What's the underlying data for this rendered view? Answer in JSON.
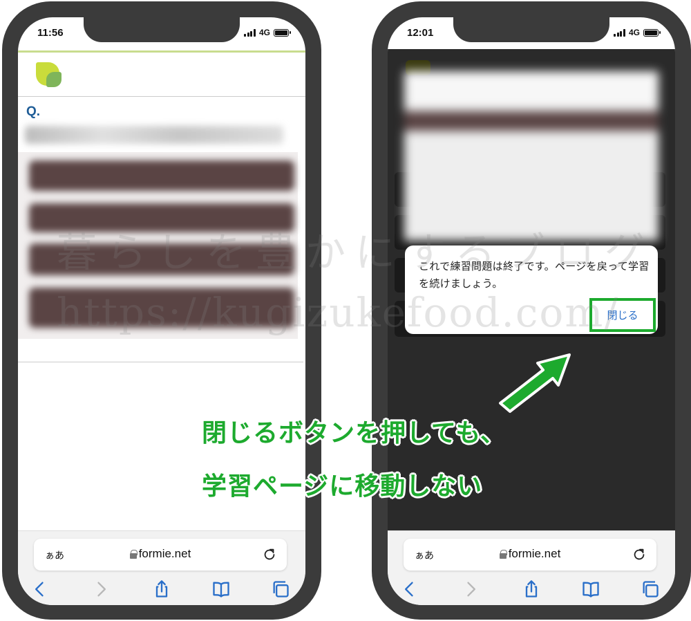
{
  "left_phone": {
    "status_time": "11:56",
    "network": "4G",
    "question_label": "Q.",
    "url_aa": "ぁあ",
    "url": "formie.net"
  },
  "right_phone": {
    "status_time": "12:01",
    "network": "4G",
    "dialog_message": "これで練習問題は終了です。ページを戻って学習を続けましょう。",
    "dialog_close_label": "閉じる",
    "url_aa": "ぁあ",
    "url": "formie.net"
  },
  "watermark": {
    "line1": "暮らしを豊かにするブログ",
    "line2": "https://kugizukefood.com/"
  },
  "caption": {
    "line1": "閉じるボタンを押しても、",
    "line2": "学習ページに移動しない"
  },
  "colors": {
    "accent_green": "#1daa2e",
    "link_blue": "#2a6fc9",
    "question_blue": "#1f5d97",
    "frame": "#3b3b3b"
  }
}
